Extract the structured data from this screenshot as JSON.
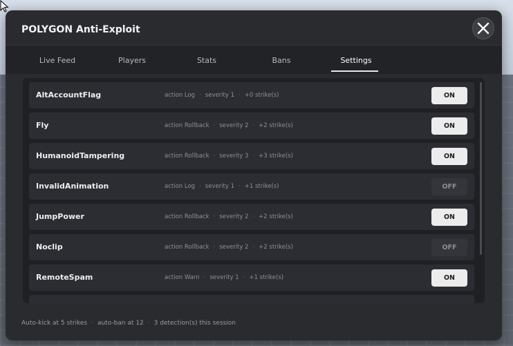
{
  "window": {
    "title": "POLYGON Anti-Exploit"
  },
  "tabs": [
    {
      "label": "Live Feed",
      "active": false
    },
    {
      "label": "Players",
      "active": false
    },
    {
      "label": "Stats",
      "active": false
    },
    {
      "label": "Bans",
      "active": false
    },
    {
      "label": "Settings",
      "active": true
    }
  ],
  "detections": [
    {
      "name": "AltAccountFlag",
      "action": "action Log",
      "severity": "severity 1",
      "strikes": "+0 strike(s)",
      "toggle": "ON"
    },
    {
      "name": "Fly",
      "action": "action Rollback",
      "severity": "severity 2",
      "strikes": "+2 strike(s)",
      "toggle": "ON"
    },
    {
      "name": "HumanoidTampering",
      "action": "action Rollback",
      "severity": "severity 3",
      "strikes": "+3 strike(s)",
      "toggle": "ON"
    },
    {
      "name": "InvalidAnimation",
      "action": "action Log",
      "severity": "severity 1",
      "strikes": "+1 strike(s)",
      "toggle": "OFF"
    },
    {
      "name": "JumpPower",
      "action": "action Rollback",
      "severity": "severity 2",
      "strikes": "+2 strike(s)",
      "toggle": "ON"
    },
    {
      "name": "Noclip",
      "action": "action Rollback",
      "severity": "severity 2",
      "strikes": "+2 strike(s)",
      "toggle": "OFF"
    },
    {
      "name": "RemoteSpam",
      "action": "action Warn",
      "severity": "severity 1",
      "strikes": "+1 strike(s)",
      "toggle": "ON"
    }
  ],
  "footer": {
    "auto_kick": "Auto-kick at 5 strikes",
    "auto_ban": "auto-ban at 12",
    "session": "3 detection(s) this session"
  },
  "colors": {
    "panel": "#2a2b2f",
    "toggle_on": "#ececec",
    "toggle_off": "#34353a"
  },
  "icons": {
    "close": "close-icon",
    "cursor": "mouse-cursor-icon"
  }
}
